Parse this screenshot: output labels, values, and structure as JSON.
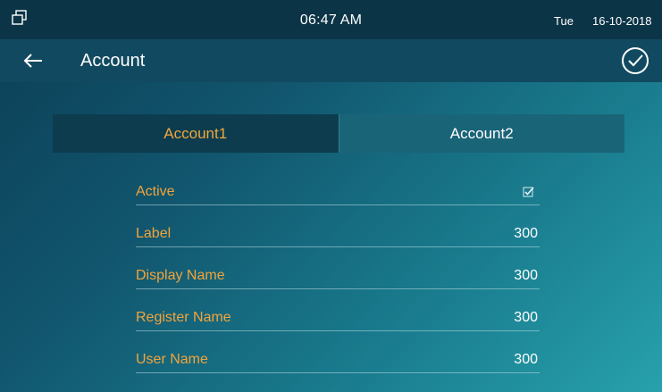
{
  "status_bar": {
    "time": "06:47 AM",
    "day": "Tue",
    "date": "16-10-2018"
  },
  "header": {
    "title": "Account"
  },
  "tabs": [
    {
      "label": "Account1",
      "active": true
    },
    {
      "label": "Account2",
      "active": false
    }
  ],
  "fields": [
    {
      "label": "Active",
      "checked": true
    },
    {
      "label": "Label",
      "value": "300"
    },
    {
      "label": "Display Name",
      "value": "300"
    },
    {
      "label": "Register Name",
      "value": "300"
    },
    {
      "label": "User Name",
      "value": "300"
    }
  ],
  "colors": {
    "accent_orange": "#f2a43c",
    "status_bar_bg": "#0c3447",
    "header_bg": "#114a60",
    "active_tab_bg": "#0d3c4f",
    "inactive_tab_bg": "#1a6478"
  },
  "icons": {
    "status_left": "window-icon",
    "back": "arrow-left-icon",
    "confirm": "check-circle-icon",
    "active_toggle": "checkbox-checked-icon"
  }
}
